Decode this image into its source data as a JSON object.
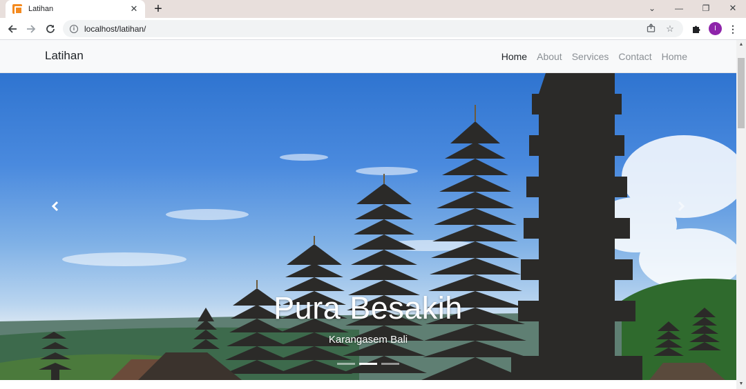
{
  "browser": {
    "tab_title": "Latihan",
    "tab_close": "✕",
    "new_tab": "+",
    "url": "localhost/latihan/",
    "window_controls": {
      "tab_search": "⌄",
      "minimize": "—",
      "restore": "❐",
      "close": "✕"
    },
    "profile_initial": "I",
    "icons": {
      "favicon": "xampp-icon",
      "back": "arrow-left-icon",
      "forward": "arrow-right-icon",
      "reload": "reload-icon",
      "site_info": "info-icon",
      "share": "share-icon",
      "bookmark": "star-icon",
      "extensions": "puzzle-icon",
      "menu": "kebab-menu-icon"
    }
  },
  "navbar": {
    "brand": "Latihan",
    "links": [
      {
        "label": "Home",
        "active": true
      },
      {
        "label": "About",
        "active": false
      },
      {
        "label": "Services",
        "active": false
      },
      {
        "label": "Contact",
        "active": false
      },
      {
        "label": "Home",
        "active": false
      }
    ]
  },
  "carousel": {
    "slide": {
      "title": "Pura Besakih",
      "subtitle": "Karangasem Bali"
    },
    "indicators": {
      "count": 3,
      "active_index": 1
    },
    "controls": {
      "prev_icon": "chevron-left-icon",
      "next_icon": "chevron-right-icon"
    }
  },
  "colors": {
    "sky_top": "#2f74d0",
    "navbar_bg": "#f8f9fa",
    "tab_strip_bg": "#e8dfdc",
    "avatar_bg": "#8e24aa",
    "favicon": "#f48a1f"
  }
}
